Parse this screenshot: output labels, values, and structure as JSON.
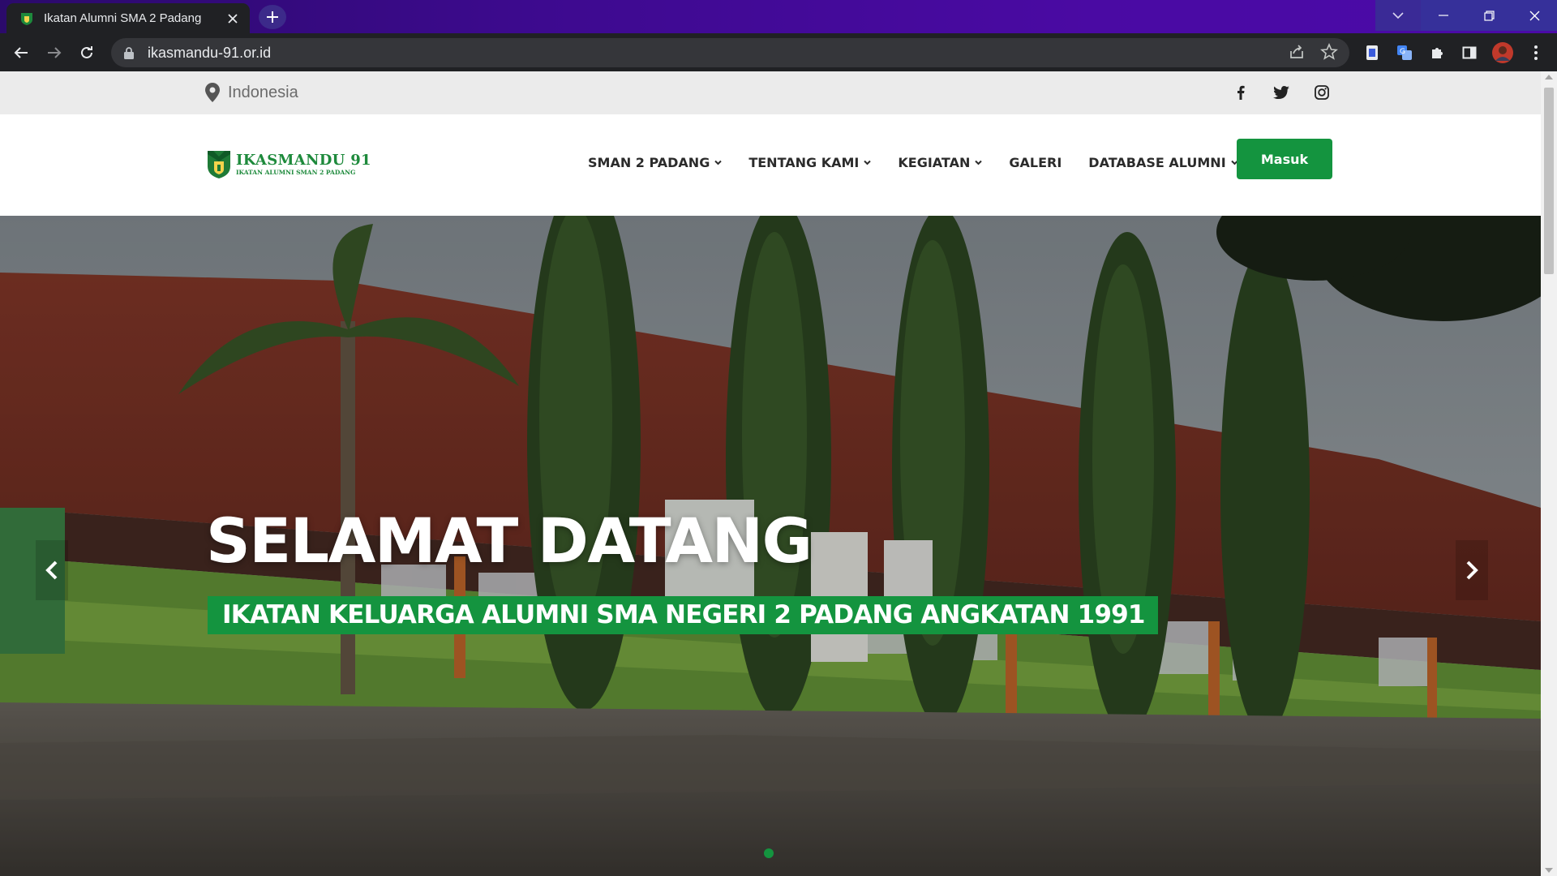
{
  "browser": {
    "tab_title": "Ikatan Alumni SMA 2 Padang",
    "url": "ikasmandu-91.or.id",
    "icons": [
      "back-icon",
      "forward-icon",
      "reload-icon",
      "lock-icon",
      "share-icon",
      "star-icon",
      "extension-icon",
      "translate-icon",
      "puzzle-icon",
      "sidepanel-icon",
      "profile-avatar",
      "more-icon"
    ],
    "accent_colors": {
      "tabstrip_start": "#2b0a6b",
      "tabstrip_end": "#4b0aa8"
    }
  },
  "topbar": {
    "location": "Indonesia",
    "socials": [
      "facebook-icon",
      "twitter-icon",
      "instagram-icon"
    ]
  },
  "navbar": {
    "logo_main": "IKASMANDU 91",
    "logo_sub": "IKATAN ALUMNI SMAN 2 PADANG",
    "menu": [
      {
        "label": "SMAN 2 PADANG",
        "dropdown": true
      },
      {
        "label": "TENTANG KAMI",
        "dropdown": true
      },
      {
        "label": "KEGIATAN",
        "dropdown": true
      },
      {
        "label": "GALERI",
        "dropdown": false
      },
      {
        "label": "DATABASE ALUMNI",
        "dropdown": true
      }
    ],
    "login_label": "Masuk",
    "brand_color": "#14943f"
  },
  "hero": {
    "title": "SELAMAT DATANG",
    "subtitle": "IKATAN KELUARGA ALUMNI SMA NEGERI 2 PADANG ANGKATAN 1991"
  }
}
